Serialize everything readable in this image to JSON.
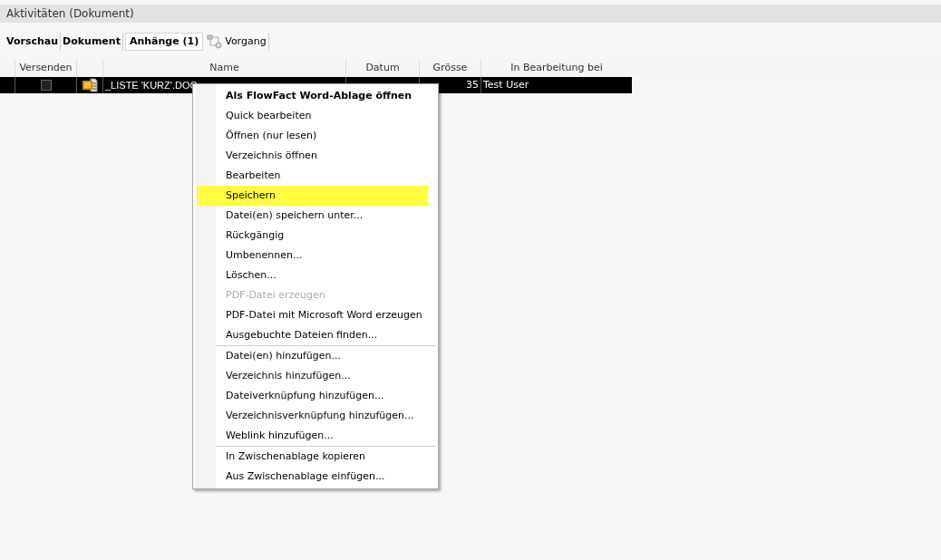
{
  "panel": {
    "title": "Aktivitäten (Dokument)"
  },
  "tabs": [
    {
      "label": "Vorschau",
      "selected": false,
      "icon": false
    },
    {
      "label": "Dokument",
      "selected": false,
      "icon": false
    },
    {
      "label": "Anhänge (1)",
      "selected": true,
      "icon": false
    },
    {
      "label": "Vorgang",
      "selected": false,
      "icon": true
    }
  ],
  "table": {
    "columns": [
      "Versenden",
      "Name",
      "Datum",
      "Grösse",
      "In Bearbeitung bei"
    ],
    "rows": [
      {
        "selected": true,
        "checked": false,
        "name": "_LISTE 'KURZ'.DOC",
        "size": "35",
        "editor": "Test User"
      }
    ]
  },
  "context_menu": [
    {
      "label": "Als FlowFact Word-Ablage öffnen",
      "bold": true,
      "disabled": false,
      "selected": false,
      "separator_before": false
    },
    {
      "label": "Quick bearbeiten",
      "bold": false,
      "disabled": false,
      "selected": false,
      "separator_before": false
    },
    {
      "label": "Öffnen (nur lesen)",
      "bold": false,
      "disabled": false,
      "selected": false,
      "separator_before": false
    },
    {
      "label": "Verzeichnis öffnen",
      "bold": false,
      "disabled": false,
      "selected": false,
      "separator_before": false
    },
    {
      "label": "Bearbeiten",
      "bold": false,
      "disabled": false,
      "selected": false,
      "separator_before": false
    },
    {
      "label": "Speichern",
      "bold": false,
      "disabled": false,
      "selected": true,
      "separator_before": false
    },
    {
      "label": "Datei(en) speichern unter...",
      "bold": false,
      "disabled": false,
      "selected": false,
      "separator_before": false
    },
    {
      "label": "Rückgängig",
      "bold": false,
      "disabled": false,
      "selected": false,
      "separator_before": false
    },
    {
      "label": "Umbenennen...",
      "bold": false,
      "disabled": false,
      "selected": false,
      "separator_before": false
    },
    {
      "label": "Löschen...",
      "bold": false,
      "disabled": false,
      "selected": false,
      "separator_before": false
    },
    {
      "label": "PDF-Datei erzeugen",
      "bold": false,
      "disabled": true,
      "selected": false,
      "separator_before": false
    },
    {
      "label": "PDF-Datei mit Microsoft Word erzeugen",
      "bold": false,
      "disabled": false,
      "selected": false,
      "separator_before": false
    },
    {
      "label": "Ausgebuchte Dateien finden...",
      "bold": false,
      "disabled": false,
      "selected": false,
      "separator_before": false
    },
    {
      "label": "Datei(en) hinzufügen...",
      "bold": false,
      "disabled": false,
      "selected": false,
      "separator_before": true
    },
    {
      "label": "Verzeichnis hinzufügen...",
      "bold": false,
      "disabled": false,
      "selected": false,
      "separator_before": false
    },
    {
      "label": "Dateiverknüpfung hinzufügen...",
      "bold": false,
      "disabled": false,
      "selected": false,
      "separator_before": false
    },
    {
      "label": "Verzeichnisverknüpfung hinzufügen...",
      "bold": false,
      "disabled": false,
      "selected": false,
      "separator_before": false
    },
    {
      "label": "Weblink hinzufügen...",
      "bold": false,
      "disabled": false,
      "selected": false,
      "separator_before": false
    },
    {
      "label": "In Zwischenablage kopieren",
      "bold": false,
      "disabled": false,
      "selected": false,
      "separator_before": true
    },
    {
      "label": "Aus Zwischenablage einfügen...",
      "bold": false,
      "disabled": false,
      "selected": false,
      "separator_before": false
    }
  ]
}
